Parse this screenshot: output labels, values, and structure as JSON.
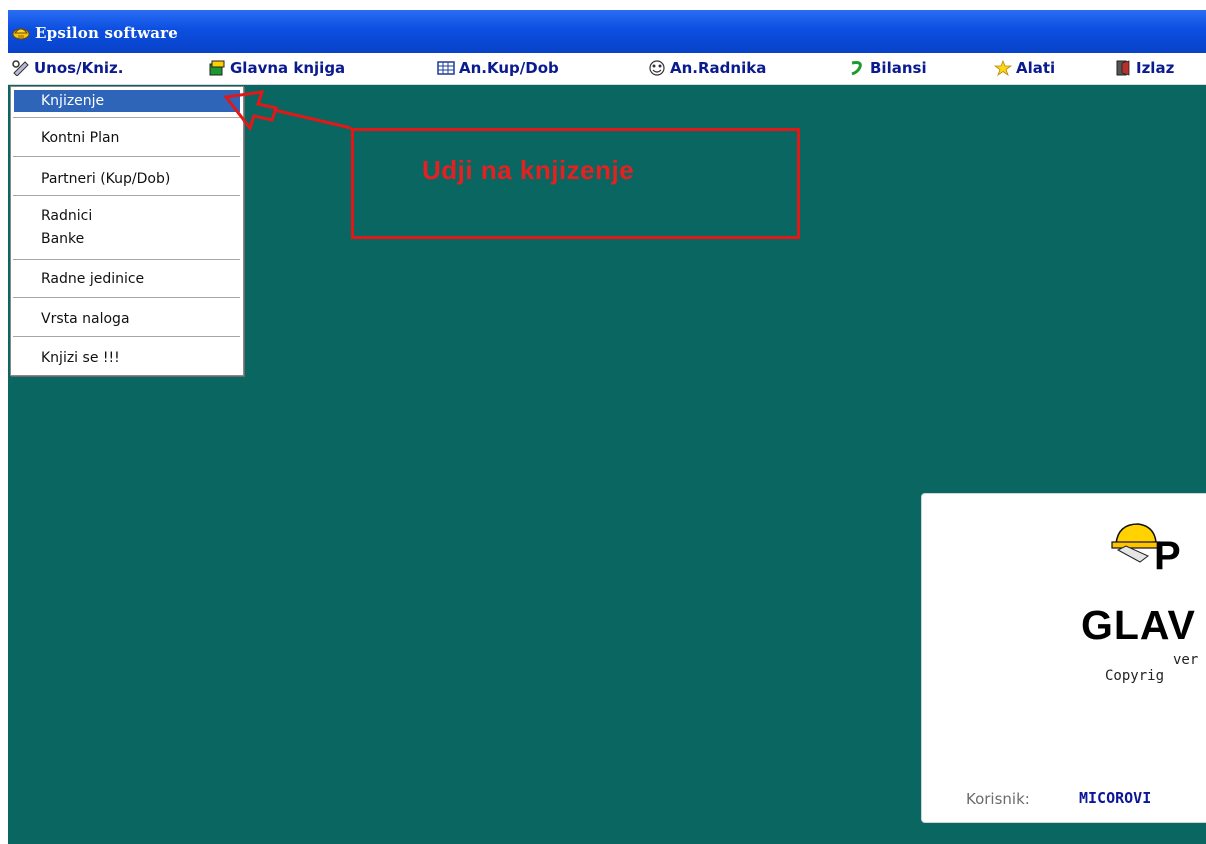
{
  "window": {
    "title": "Epsilon software"
  },
  "menubar": {
    "items": [
      {
        "label": "Unos/Kniz.",
        "icon": "tools-icon"
      },
      {
        "label": "Glavna knjiga",
        "icon": "book-icon"
      },
      {
        "label": "An.Kup/Dob",
        "icon": "grid-icon"
      },
      {
        "label": "An.Radnika",
        "icon": "face-icon"
      },
      {
        "label": "Bilansi",
        "icon": "snake-icon"
      },
      {
        "label": "Alati",
        "icon": "star-icon"
      },
      {
        "label": "Izlaz",
        "icon": "door-icon"
      }
    ]
  },
  "dropdown": {
    "items": [
      "Knjizenje",
      "Kontni Plan",
      "Partneri (Kup/Dob)",
      "Radnici",
      "Banke",
      "Radne jedinice",
      "Vrsta naloga",
      "Knjizi se !!!"
    ],
    "selected": "Knjizenje"
  },
  "annotation": {
    "text": "Udji na knjizenje",
    "color": "#e62020"
  },
  "splash": {
    "logo_text": "P",
    "product": "GLAV",
    "version": "ver",
    "copyright": "Copyrig",
    "user_label": "Korisnik:",
    "user_value": "MICOROVI"
  },
  "colors": {
    "titlebar": "#0c4fe0",
    "desktop": "#0a6660",
    "menu_text": "#0b1b8f",
    "selection": "#2f65b9"
  }
}
